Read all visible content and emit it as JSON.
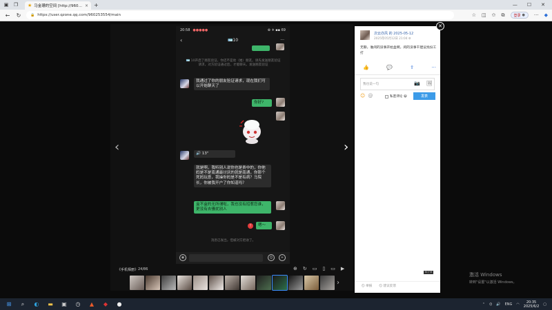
{
  "browser": {
    "tab_title": "马金珊的空间 [http://960253554/ ×",
    "tab_title_short": "马金珊的空间 [http://960253554/",
    "url": "https://user.qzone.qq.com/960253554/main",
    "login_label": "登录"
  },
  "phone": {
    "time": "20:58",
    "status_right": "⊕ ✈ ▪▪ 69",
    "chat_title": "🪪10",
    "more": "···",
    "system_note": "🪪 10开启了朋友验证，你还不是他（她）朋友。请先发送朋友验证请求，对方验证通过后，才能聊天。发送朋友验证",
    "messages": [
      {
        "side": "left",
        "text": "我通过了你的朋友验证请求，现在我们可以开始聊天了"
      },
      {
        "side": "right",
        "text": "你好?"
      },
      {
        "side": "left",
        "text": "🔊 13\""
      },
      {
        "side": "left",
        "text": "就是啊，我听别人说你也是贵中的，你他妈是不是南通最讨厌的就是南通，你那个死妈玩意，我操你妈是不是有病？马院长，你被我开户了你知道吗？"
      },
      {
        "side": "right",
        "text": "盒不盒的无所谓啦，我也没有招惹您谁，更没有去骚扰别人"
      },
      {
        "side": "right",
        "text": "嗯～"
      }
    ],
    "sent_note": "消息已发出，但被对方拒收了。",
    "error_mark": "!"
  },
  "viewer": {
    "album_label": "《手机相册》",
    "album_count": "24/86",
    "tag_counter": "0 / 0"
  },
  "panel": {
    "user_name": "次云亦风 的 2025-05-12",
    "user_date": "2025年05月12日 21:04 ⚙",
    "post_text": "无聊，谁闲的没事开始盒啊，闲的没事干建议找份工打",
    "comment_placeholder": "我也说一句",
    "private_label": "私密评论 😀",
    "send_label": "发表",
    "bottom_left": "🛇 举报",
    "bottom_right": "🛇 建议反馈"
  },
  "watermark": {
    "line1": "激活 Windows",
    "line2": "转到\"设置\"以激活 Windows。"
  },
  "taskbar": {
    "lang": "ENG",
    "time": "20:35",
    "date": "2025/6/2"
  }
}
